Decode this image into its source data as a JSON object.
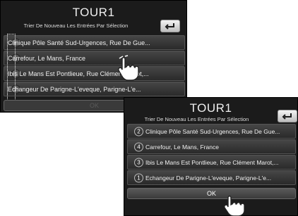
{
  "back_screen": {
    "title": "TOUR1",
    "subtitle": "Trier De Nouveau Les Entrées Par Sélection",
    "items": [
      {
        "label": "Clinique Pôle Santé Sud-Urgences, Rue De Gue..."
      },
      {
        "label": "Carrefour, Le Mans, France"
      },
      {
        "label": "Ibis Le Mans Est Pontlieue, Rue Clément Marot,..."
      },
      {
        "label": "Echangeur De Parigne-L'eveque, Parigne-L'e..."
      }
    ],
    "ok_label": "OK"
  },
  "front_screen": {
    "title": "TOUR1",
    "subtitle": "Trier De Nouveau Les Entrées Par Sélection",
    "items": [
      {
        "number": "2",
        "label": "Clinique Pôle Santé Sud-Urgences, Rue De Gue..."
      },
      {
        "number": "4",
        "label": "Carrefour, Le Mans, France"
      },
      {
        "number": "3",
        "label": "Ibis Le Mans Est Pontlieue, Rue Clément Marot,..."
      },
      {
        "number": "1",
        "label": "Echangeur De Parigne-L'eveque, Parigne-L'e..."
      }
    ],
    "ok_label": "OK"
  },
  "icons": {
    "back": "return-arrow-icon",
    "pointer": "hand-pointer-icon"
  }
}
